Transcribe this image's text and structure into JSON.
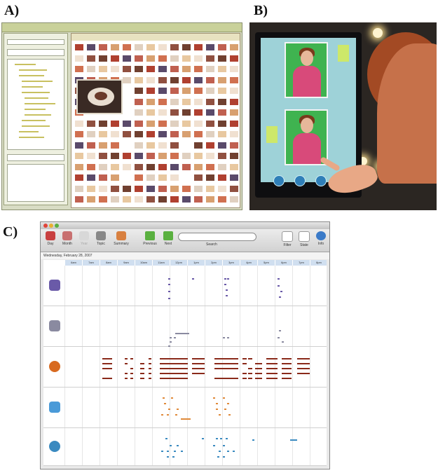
{
  "panel_labels": {
    "a": "A)",
    "b": "B)",
    "c": "C)"
  },
  "panel_c": {
    "toolbar": {
      "day": "Day",
      "month": "Month",
      "year": "Year",
      "topic": "Topic",
      "summary": "Summary",
      "previous": "Previous",
      "next": "Next",
      "search": "Search",
      "filter": "Filter",
      "state": "State",
      "info": "Info"
    },
    "date_label": "Wednesday, February 28, 2007",
    "hours": [
      "6am",
      "7am",
      "8am",
      "9am",
      "10am",
      "11am",
      "12pm",
      "1pm",
      "2pm",
      "3pm",
      "4pm",
      "5pm",
      "6pm",
      "7pm",
      "8pm"
    ],
    "colors": {
      "row1": "#6a5aa8",
      "row2": "#8a8aa0",
      "row3": "#8a2a1a",
      "row4": "#e08a3a",
      "row5": "#3a8ac0"
    }
  }
}
